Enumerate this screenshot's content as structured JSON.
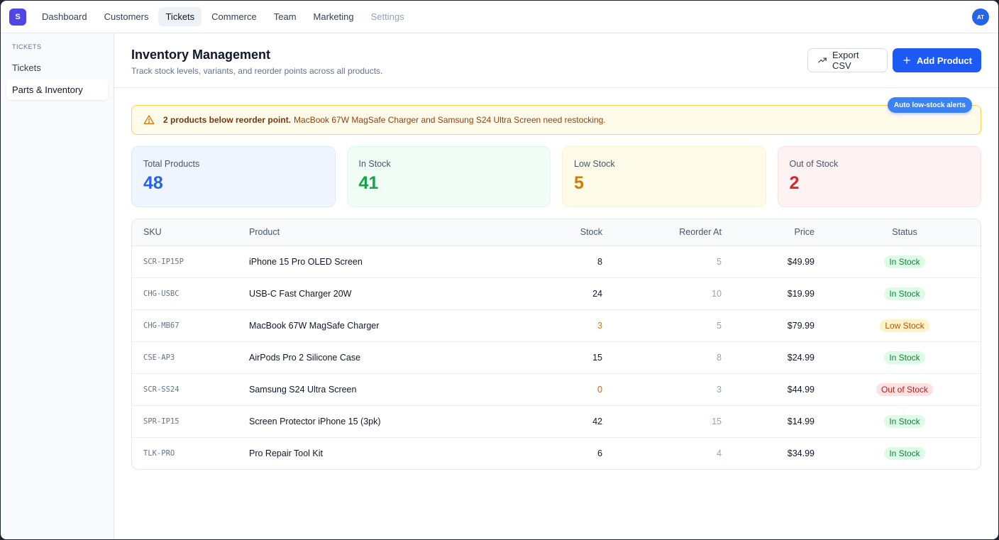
{
  "app": {
    "logo_letter": "S",
    "avatar_initials": "AT"
  },
  "nav": {
    "items": [
      {
        "label": "Dashboard",
        "state": "normal"
      },
      {
        "label": "Customers",
        "state": "normal"
      },
      {
        "label": "Tickets",
        "state": "active"
      },
      {
        "label": "Commerce",
        "state": "normal"
      },
      {
        "label": "Team",
        "state": "normal"
      },
      {
        "label": "Marketing",
        "state": "normal"
      },
      {
        "label": "Settings",
        "state": "muted"
      }
    ]
  },
  "sidebar": {
    "section": "TICKETS",
    "items": [
      {
        "label": "Tickets",
        "active": false
      },
      {
        "label": "Parts & Inventory",
        "active": true
      }
    ]
  },
  "header": {
    "title": "Inventory Management",
    "subtitle": "Track stock levels, variants, and reorder points across all products.",
    "export_label": "Export CSV",
    "add_label": "Add Product"
  },
  "alert": {
    "bold": "2 products below reorder point.",
    "text": "MacBook 67W MagSafe Charger and Samsung S24 Ultra Screen need restocking.",
    "badge": "Auto low-stock alerts"
  },
  "stats": [
    {
      "label": "Total Products",
      "value": "48",
      "tone": "blue"
    },
    {
      "label": "In Stock",
      "value": "41",
      "tone": "green"
    },
    {
      "label": "Low Stock",
      "value": "5",
      "tone": "yellow"
    },
    {
      "label": "Out of Stock",
      "value": "2",
      "tone": "red"
    }
  ],
  "table": {
    "columns": [
      "SKU",
      "Product",
      "Stock",
      "Reorder At",
      "Price",
      "Status"
    ],
    "rows": [
      {
        "sku": "SCR-IP15P",
        "product": "iPhone 15 Pro OLED Screen",
        "stock": "8",
        "reorder": "5",
        "price": "$49.99",
        "status": "In Stock",
        "tone": "in"
      },
      {
        "sku": "CHG-USBC",
        "product": "USB-C Fast Charger 20W",
        "stock": "24",
        "reorder": "10",
        "price": "$19.99",
        "status": "In Stock",
        "tone": "in"
      },
      {
        "sku": "CHG-MB67",
        "product": "MacBook 67W MagSafe Charger",
        "stock": "3",
        "reorder": "5",
        "price": "$79.99",
        "status": "Low Stock",
        "tone": "low"
      },
      {
        "sku": "CSE-AP3",
        "product": "AirPods Pro 2 Silicone Case",
        "stock": "15",
        "reorder": "8",
        "price": "$24.99",
        "status": "In Stock",
        "tone": "in"
      },
      {
        "sku": "SCR-SS24",
        "product": "Samsung S24 Ultra Screen",
        "stock": "0",
        "reorder": "3",
        "price": "$44.99",
        "status": "Out of Stock",
        "tone": "out"
      },
      {
        "sku": "SPR-IP15",
        "product": "Screen Protector iPhone 15 (3pk)",
        "stock": "42",
        "reorder": "15",
        "price": "$14.99",
        "status": "In Stock",
        "tone": "in"
      },
      {
        "sku": "TLK-PRO",
        "product": "Pro Repair Tool Kit",
        "stock": "6",
        "reorder": "4",
        "price": "$34.99",
        "status": "In Stock",
        "tone": "in"
      }
    ]
  },
  "icons": {
    "export": "trend-up-icon",
    "add": "plus-icon",
    "alert": "warning-triangle-icon"
  }
}
